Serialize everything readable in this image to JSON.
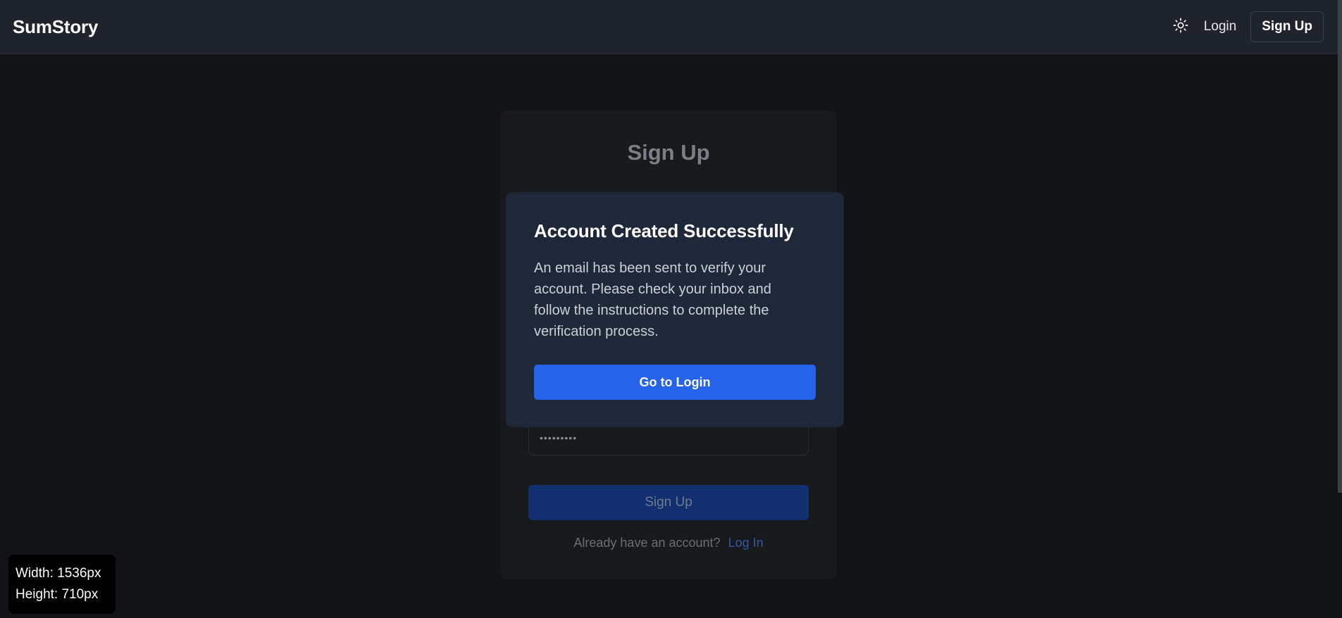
{
  "navbar": {
    "brand": "SumStory",
    "theme_icon": "sun-icon",
    "login_label": "Login",
    "signup_label": "Sign Up"
  },
  "signup_card": {
    "title": "Sign Up",
    "password_value": "•••••••••",
    "submit_label": "Sign Up",
    "already_text": "Already have an account?",
    "login_link": "Log In"
  },
  "modal": {
    "title": "Account Created Successfully",
    "body": "An email has been sent to verify your account. Please check your inbox and follow the instructions to complete the verification process.",
    "button_label": "Go to Login"
  },
  "size_badge": {
    "width_text": "Width: 1536px",
    "height_text": "Height: 710px"
  },
  "colors": {
    "accent": "#2563eb",
    "background": "#121316",
    "navbar": "#1f232b",
    "modal": "#1f2839"
  }
}
